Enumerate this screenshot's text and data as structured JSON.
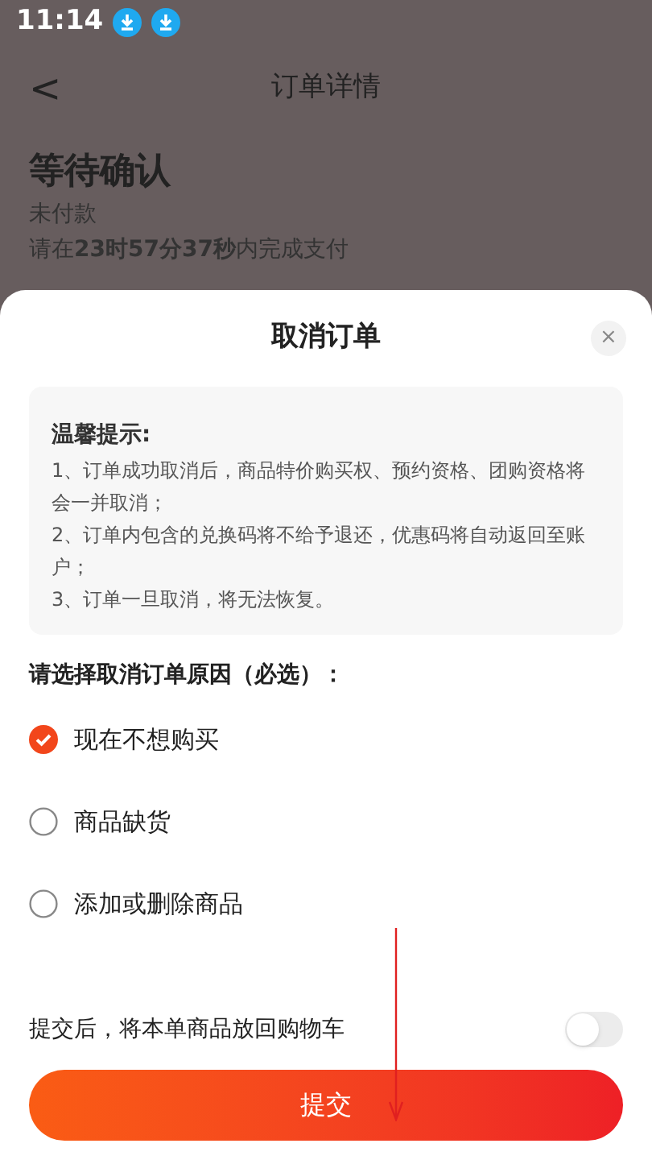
{
  "status_bar": {
    "time": "11:14",
    "notifications": [
      {
        "kind": "download"
      },
      {
        "kind": "download"
      }
    ]
  },
  "header": {
    "back": "<",
    "title": "订单详情"
  },
  "order": {
    "status": "等待确认",
    "payment": "未付款",
    "countdown": "请在**23时57分37秒**内完成支付"
  },
  "sheet": {
    "title": "取消订单",
    "close": "×",
    "notice": {
      "title": "温馨提示:",
      "lines": [
        "1、订单成功取消后，商品特价购买权、预约资格、团购资格将会一并取消；",
        "2、订单内包含的兑换码将不给予退还，优惠码将自动返回至账户；",
        "3、订单一旦取消，将无法恢复。"
      ]
    },
    "reason_label": "请选择取消订单原因（必选）：",
    "reasons": [
      {
        "label": "现在不想购买",
        "selected": true
      },
      {
        "label": "商品缺货",
        "selected": false
      },
      {
        "label": "添加或删除商品",
        "selected": false
      }
    ],
    "return_to_cart": {
      "label": "提交后，将本单商品放回购物车",
      "on": false
    },
    "submit": "提交"
  }
}
